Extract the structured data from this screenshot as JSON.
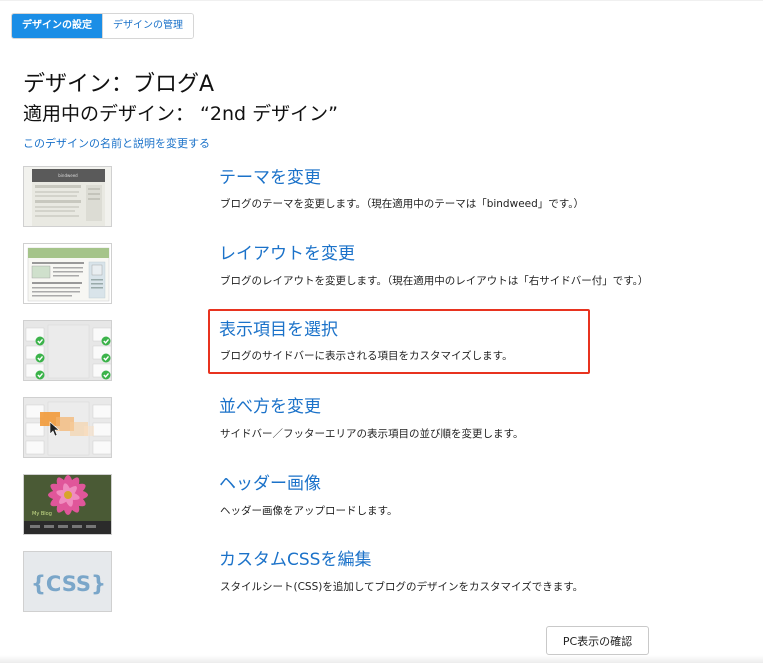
{
  "tabs": {
    "settings": "デザインの設定",
    "manage": "デザインの管理"
  },
  "header": {
    "design_title": "デザイン：ブログA",
    "applied_title": "適用中のデザイン： “2nd デザイン”",
    "rename_link": "このデザインの名前と説明を変更する"
  },
  "items": [
    {
      "title": "テーマを変更",
      "desc": "ブログのテーマを変更します。（現在適用中のテーマは「bindweed」です。）",
      "thumb_icon": "theme-thumbnail",
      "thumb_label": "bindweed"
    },
    {
      "title": "レイアウトを変更",
      "desc": "ブログのレイアウトを変更します。（現在適用中のレイアウトは「右サイドバー付」です。）",
      "thumb_icon": "layout-thumbnail"
    },
    {
      "title": "表示項目を選択",
      "desc": "ブログのサイドバーに表示される項目をカスタマイズします。",
      "thumb_icon": "widgets-checklist-thumbnail"
    },
    {
      "title": "並べ方を変更",
      "desc": "サイドバー／フッターエリアの表示項目の並び順を変更します。",
      "thumb_icon": "reorder-drag-thumbnail"
    },
    {
      "title": "ヘッダー画像",
      "desc": "ヘッダー画像をアップロードします。",
      "thumb_icon": "header-flower-thumbnail",
      "thumb_label": "My Blog"
    },
    {
      "title": "カスタムCSSを編集",
      "desc": "スタイルシート(CSS)を追加してブログのデザインをカスタマイズできます。",
      "thumb_icon": "css-braces-thumbnail",
      "thumb_label": "{CSS}"
    }
  ],
  "footer": {
    "pc_preview_button": "PC表示の確認"
  },
  "colors": {
    "accent": "#1b8ee6",
    "link": "#1b72c9",
    "highlight": "#e8331f",
    "check_green": "#3bb34a"
  }
}
